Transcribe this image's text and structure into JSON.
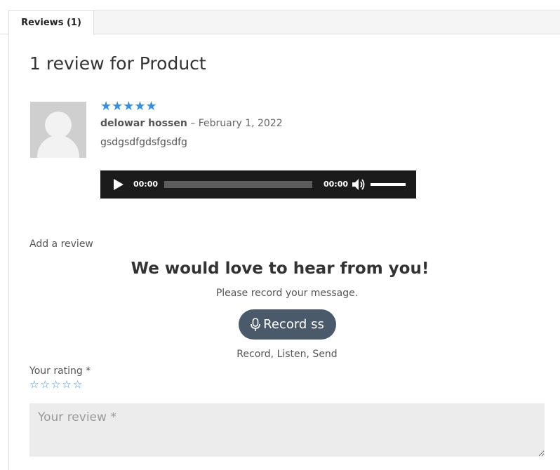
{
  "tabs": [
    {
      "label": "Reviews (1)"
    }
  ],
  "reviews": {
    "title": "1 review for Product",
    "items": [
      {
        "rating": 5,
        "stars": "★★★★★",
        "author": "delowar hossen",
        "separator": " – ",
        "date": "February 1, 2022",
        "text": "gsdgsdfgdsfgsdfg",
        "audio": {
          "current_time": "00:00",
          "duration": "00:00",
          "progress": 0,
          "volume": 1
        }
      }
    ]
  },
  "add_review": {
    "title": "Add a review",
    "heading": "We would love to hear from you!",
    "message": "Please record your message.",
    "record_button": "Record ss",
    "hint": "Record, Listen, Send",
    "rating_label": "Your rating *",
    "rating_stars": [
      "☆",
      "☆",
      "☆",
      "☆",
      "☆"
    ],
    "review_placeholder": "Your review *",
    "review_value": ""
  },
  "colors": {
    "accent": "#3b8ed8",
    "button_bg": "#4a5a6a",
    "player_bg": "#1b1b1b",
    "field_bg": "#ececec"
  }
}
